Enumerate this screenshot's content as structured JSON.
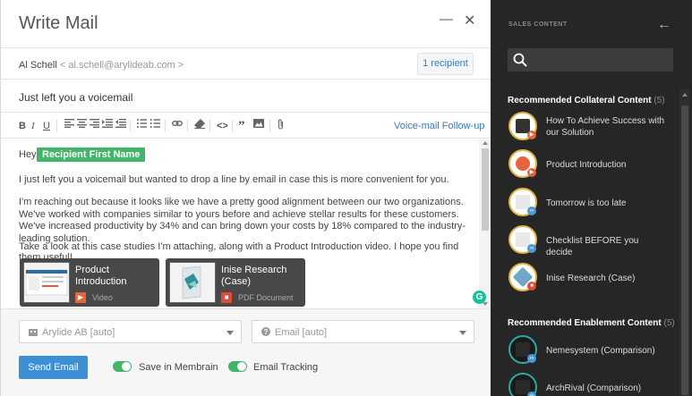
{
  "compose": {
    "title": "Write Mail",
    "to_name": "Al Schell",
    "to_email": "< al.schell@arylideab.com >",
    "recipient_btn": "1 recipient",
    "subject": "Just left you a voicemail",
    "template_link": "Voice-mail Follow-up",
    "toolbar_icons": [
      "bold-icon",
      "italic-icon",
      "underline-icon",
      "align-left-icon",
      "align-center-icon",
      "align-right-icon",
      "indent-icon",
      "outdent-icon",
      "bullet-list-icon",
      "numbered-list-icon",
      "link-icon",
      "clear-format-icon",
      "code-icon",
      "quote-icon",
      "image-icon",
      "attachment-icon"
    ],
    "body": {
      "greeting": "Hey,",
      "token": "Recipient First Name",
      "p1": "I just left you a voicemail but wanted to drop a line by email in case this is more convenient for you.",
      "p2": "I'm reaching out because it looks like we have a pretty good alignment between our two organizations. We've worked with companies similar to yours before and achieve stellar results for these customers. We've increased productivity by 34% and can bring down your costs by 18% compared to the industry-leading solution.",
      "p3": "Take a look at this case studies I'm attaching, along with a Product Introduction video.  I hope you find them useful!"
    },
    "attachments": [
      {
        "name": "Product Introduction",
        "type": "Video",
        "icon": "video-icon"
      },
      {
        "name": "Inise Research (Case)",
        "type": "PDF Document",
        "icon": "pdf-icon"
      }
    ],
    "from_select": "Arylide AB [auto]",
    "type_select": "Email [auto]",
    "send_label": "Send Email",
    "save_label": "Save in Membrain",
    "tracking_label": "Email Tracking",
    "colors": {
      "accent": "#3d8fd6",
      "token": "#43b56a",
      "toggle": "#43b56a"
    }
  },
  "sales": {
    "title": "SALES CONTENT",
    "search_placeholder": "",
    "section1": {
      "title": "Recommended Collateral Content",
      "count": "(5)"
    },
    "collateral": [
      {
        "label": "How To Achieve Success with our Solution",
        "badge": "video"
      },
      {
        "label": "Product Introduction",
        "badge": "video"
      },
      {
        "label": "Tomorrow is too late",
        "badge": "link"
      },
      {
        "label": "Checklist BEFORE you decide",
        "badge": "link"
      },
      {
        "label": "Inise Research (Case)",
        "badge": "pdf"
      }
    ],
    "section2": {
      "title": "Recommended Enablement Content",
      "count": "(5)"
    },
    "enablement": [
      {
        "label": "Nemesystem (Comparison)",
        "badge": "link"
      },
      {
        "label": "ArchRival (Comparison)",
        "badge": "link"
      }
    ],
    "colors": {
      "panel_bg": "#262626",
      "ring": "#e0b446"
    }
  }
}
